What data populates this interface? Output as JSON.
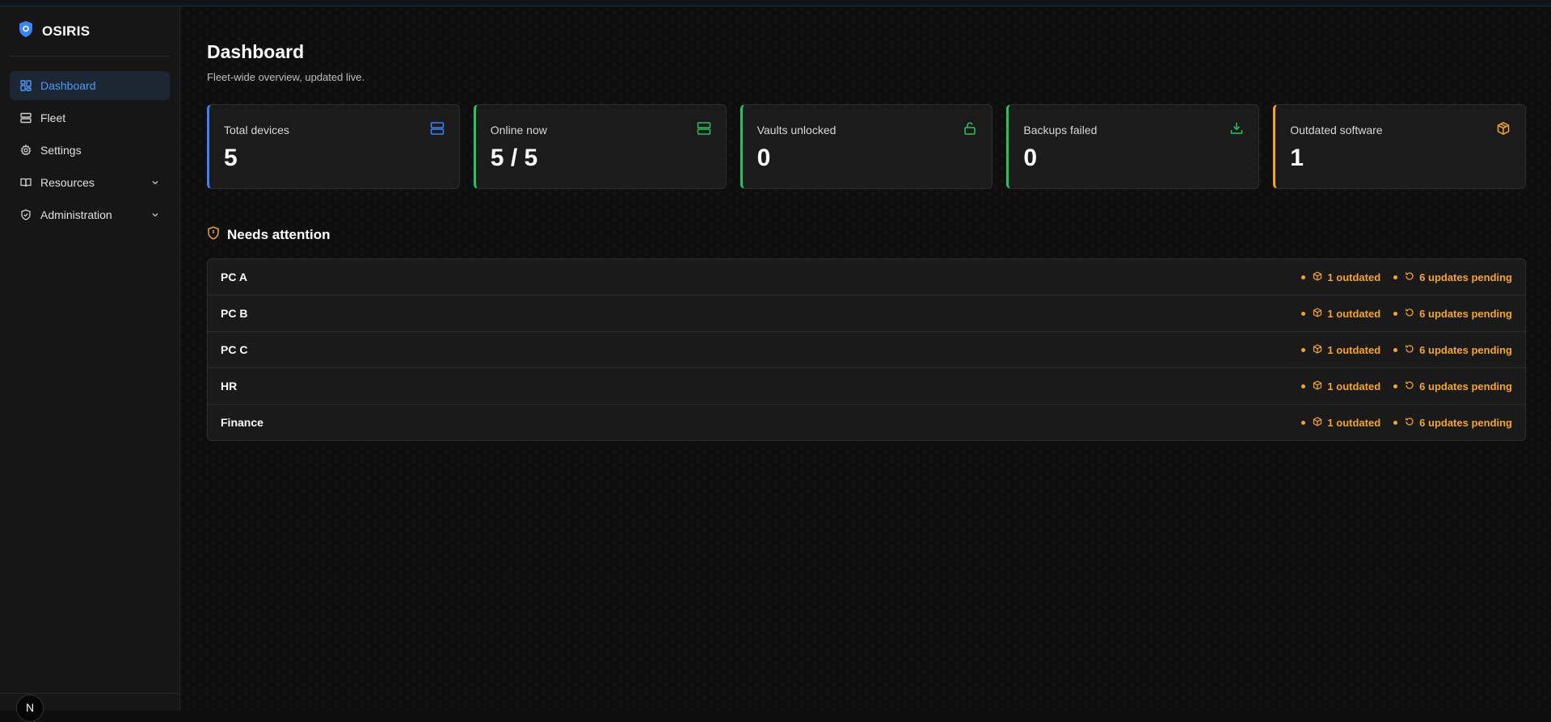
{
  "app": {
    "name": "OSIRIS",
    "avatar_initial": "N"
  },
  "sidebar": {
    "items": [
      {
        "label": "Dashboard",
        "icon": "layout-grid-icon",
        "active": true
      },
      {
        "label": "Fleet",
        "icon": "server-icon"
      },
      {
        "label": "Settings",
        "icon": "gear-icon"
      },
      {
        "label": "Resources",
        "icon": "book-icon",
        "expandable": true
      },
      {
        "label": "Administration",
        "icon": "shield-check-icon",
        "expandable": true
      }
    ]
  },
  "page": {
    "title": "Dashboard",
    "subtitle": "Fleet-wide overview, updated live."
  },
  "stats": [
    {
      "label": "Total devices",
      "value": "5",
      "icon": "server-icon",
      "accent": "#3b82f6"
    },
    {
      "label": "Online now",
      "value": "5 / 5",
      "icon": "server-icon",
      "accent": "#22c55e"
    },
    {
      "label": "Vaults unlocked",
      "value": "0",
      "icon": "unlock-icon",
      "accent": "#22c55e"
    },
    {
      "label": "Backups failed",
      "value": "0",
      "icon": "download-icon",
      "accent": "#22c55e"
    },
    {
      "label": "Outdated software",
      "value": "1",
      "icon": "package-icon",
      "accent": "#f5a524"
    }
  ],
  "attention": {
    "title": "Needs attention",
    "warning_color": "#f5a524",
    "rows": [
      {
        "name": "PC A",
        "outdated": "1 outdated",
        "updates": "6 updates pending"
      },
      {
        "name": "PC B",
        "outdated": "1 outdated",
        "updates": "6 updates pending"
      },
      {
        "name": "PC C",
        "outdated": "1 outdated",
        "updates": "6 updates pending"
      },
      {
        "name": "HR",
        "outdated": "1 outdated",
        "updates": "6 updates pending"
      },
      {
        "name": "Finance",
        "outdated": "1 outdated",
        "updates": "6 updates pending"
      }
    ]
  }
}
